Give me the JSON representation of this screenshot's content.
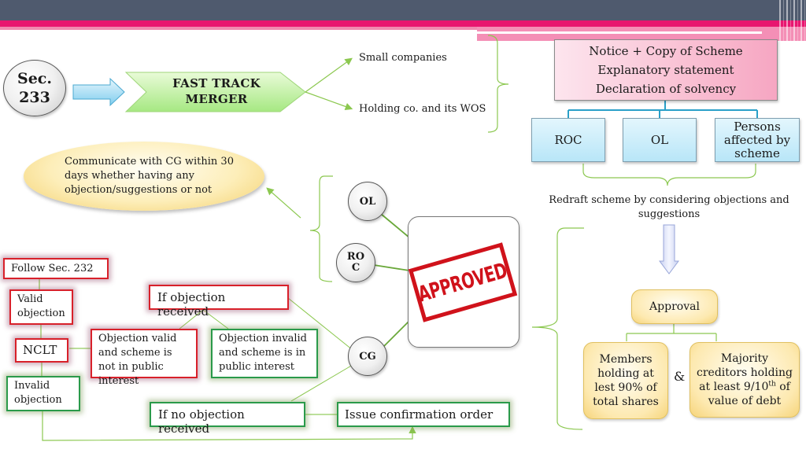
{
  "header": {
    "accent_colors": {
      "dark": "#4f5a6e",
      "pink": "#e8166f",
      "light_pink": "#f48fb6"
    }
  },
  "section": {
    "line1": "Sec.",
    "line2": "233"
  },
  "fast_track": {
    "line1": "FAST  TRACK",
    "line2": "MERGER"
  },
  "applicable_to": [
    "Small companies",
    "Holding co. and its WOS"
  ],
  "notice_box": {
    "lines": [
      "Notice + Copy of Scheme",
      "Explanatory statement",
      "Declaration of solvency"
    ]
  },
  "recipients": [
    {
      "label": "ROC"
    },
    {
      "label": "OL"
    },
    {
      "label": "Persons affected by scheme"
    }
  ],
  "communicate": {
    "text": "Communicate with CG within 30 days whether having any objection/suggestions or not"
  },
  "redraft": {
    "text": "Redraft scheme by considering objections and suggestions"
  },
  "authorities": [
    {
      "label": "OL"
    },
    {
      "label_line1": "RO",
      "label_line2": "C"
    },
    {
      "label": "CG"
    }
  ],
  "stamp": {
    "text": "APPROVED",
    "color": "#d0121b"
  },
  "approval": {
    "label": "Approval",
    "members": "Members holding at lest 90% of total shares",
    "connector": "&",
    "creditors_pre": "Majority creditors holding at least 9/10",
    "creditors_sup": "th",
    "creditors_post": " of value of debt"
  },
  "left_flow": {
    "follow": "Follow Sec. 232",
    "valid": "Valid objection",
    "nclt": "NCLT",
    "invalid": "Invalid objection"
  },
  "objection_flow": {
    "if_received": "If objection received",
    "valid_case": "Objection valid and scheme is not in public interest",
    "invalid_case": "Objection invalid and scheme is in public interest",
    "if_not_received": "If no objection received",
    "confirmation": "Issue confirmation order"
  }
}
